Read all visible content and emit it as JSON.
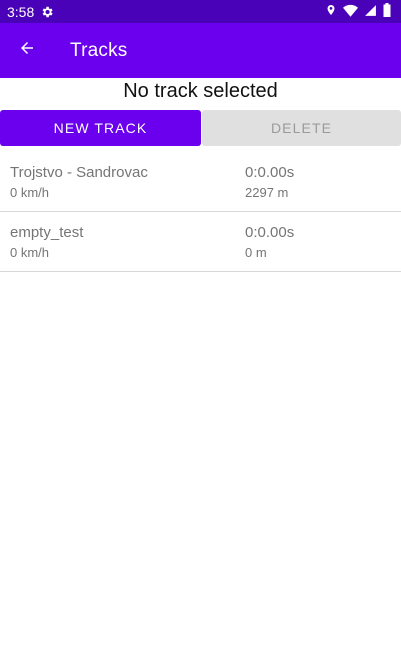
{
  "status_bar": {
    "time": "3:58",
    "icons": [
      "gear-icon",
      "location-icon",
      "wifi-icon",
      "signal-icon",
      "battery-icon"
    ]
  },
  "app_bar": {
    "title": "Tracks",
    "back_icon": "arrow-back-icon",
    "color": "#6a00ee"
  },
  "selection": {
    "title": "No track selected"
  },
  "buttons": {
    "new_track": "NEW TRACK",
    "delete": "DELETE"
  },
  "tracks": [
    {
      "name": "Trojstvo - Sandrovac",
      "speed": "0 km/h",
      "time": "0:0.00s",
      "distance": "2297 m"
    },
    {
      "name": "empty_test",
      "speed": "0 km/h",
      "time": "0:0.00s",
      "distance": "0 m"
    }
  ],
  "colors": {
    "status_bar": "#4a02b8",
    "accent": "#6a00ee",
    "disabled_button": "#e0e0e0"
  }
}
